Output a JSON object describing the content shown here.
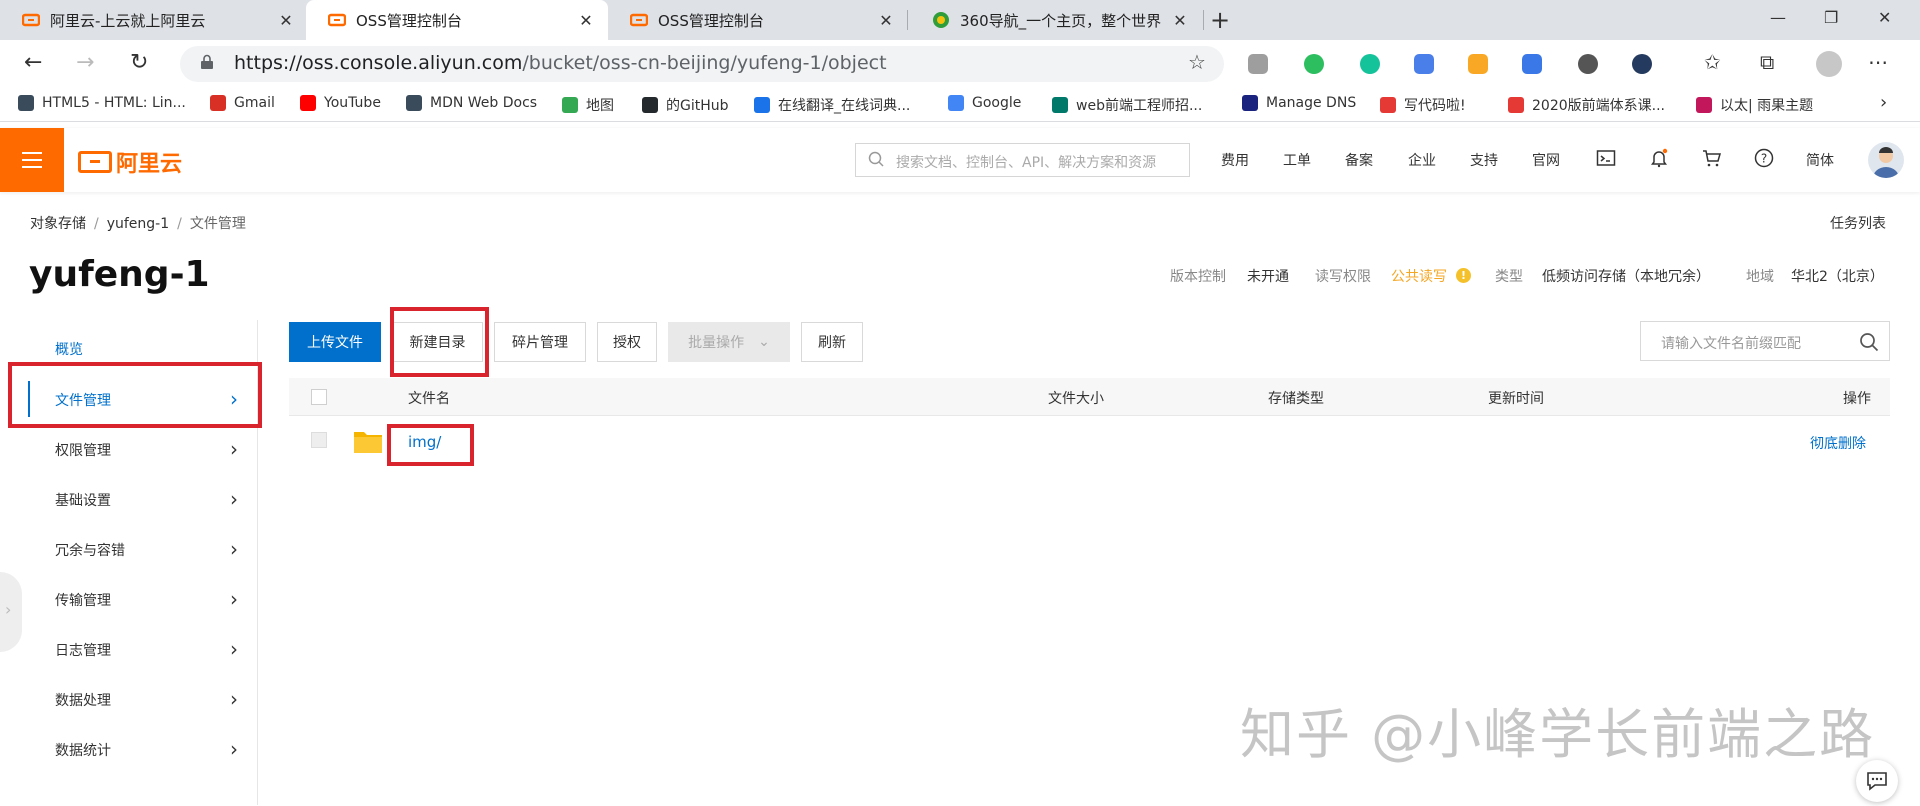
{
  "browser": {
    "tabs": [
      {
        "title": "阿里云-上云就上阿里云",
        "active": false
      },
      {
        "title": "OSS管理控制台",
        "active": true
      },
      {
        "title": "OSS管理控制台",
        "active": false
      },
      {
        "title": "360导航_一个主页，整个世界",
        "active": false
      }
    ],
    "new_tab": "+",
    "url_host": "https://oss.console.aliyun.com",
    "url_path": "/bucket/oss-cn-beijing/yufeng-1/object",
    "bookmarks": [
      {
        "label": "HTML5 - HTML: Lin...",
        "color": "#3a4b5c"
      },
      {
        "label": "Gmail",
        "color": "#d93025"
      },
      {
        "label": "YouTube",
        "color": "#ff0000"
      },
      {
        "label": "MDN Web Docs",
        "color": "#3a4b5c"
      },
      {
        "label": "地图",
        "color": "#34a853"
      },
      {
        "label": "的GitHub",
        "color": "#24292e"
      },
      {
        "label": "在线翻译_在线词典...",
        "color": "#1a73e8"
      },
      {
        "label": "Google",
        "color": "#4285f4"
      },
      {
        "label": "web前端工程师招...",
        "color": "#00796b"
      },
      {
        "label": "Manage DNS",
        "color": "#1a237e"
      },
      {
        "label": "写代码啦!",
        "color": "#e53935"
      },
      {
        "label": "2020版前端体系课...",
        "color": "#e53935"
      },
      {
        "label": "以太| 雨果主题",
        "color": "#c2185b"
      }
    ]
  },
  "header": {
    "logo_text": "阿里云",
    "search_placeholder": "搜索文档、控制台、API、解决方案和资源",
    "nav": [
      "费用",
      "工单",
      "备案",
      "企业",
      "支持",
      "官网"
    ],
    "lang": "简体"
  },
  "breadcrumb": {
    "items": [
      "对象存储",
      "yufeng-1",
      "文件管理"
    ]
  },
  "task_list": "任务列表",
  "bucket": {
    "name": "yufeng-1",
    "meta": {
      "version_label": "版本控制",
      "version_value": "未开通",
      "acl_label": "读写权限",
      "acl_value": "公共读写",
      "type_label": "类型",
      "type_value": "低频访问存储（本地冗余）",
      "region_label": "地域",
      "region_value": "华北2（北京）"
    }
  },
  "sidebar": {
    "items": [
      {
        "label": "概览"
      },
      {
        "label": "文件管理"
      },
      {
        "label": "权限管理"
      },
      {
        "label": "基础设置"
      },
      {
        "label": "冗余与容错"
      },
      {
        "label": "传输管理"
      },
      {
        "label": "日志管理"
      },
      {
        "label": "数据处理"
      },
      {
        "label": "数据统计"
      }
    ]
  },
  "toolbar": {
    "upload": "上传文件",
    "new_dir": "新建目录",
    "fragments": "碎片管理",
    "authorize": "授权",
    "batch": "批量操作",
    "refresh": "刷新",
    "search_placeholder": "请输入文件名前缀匹配"
  },
  "table": {
    "columns": [
      "文件名",
      "文件大小",
      "存储类型",
      "更新时间",
      "操作"
    ],
    "rows": [
      {
        "name": "img/",
        "action": "彻底删除"
      }
    ]
  },
  "watermark": "知乎 @小峰学长前端之路",
  "colors": {
    "brand": "#ff6a00",
    "link": "#0070cc",
    "highlight": "#d9232d",
    "warn": "#f5a623"
  }
}
